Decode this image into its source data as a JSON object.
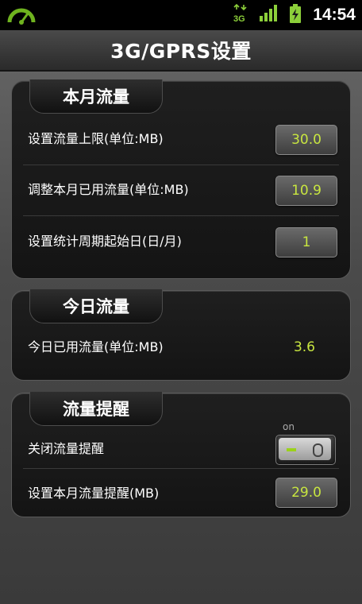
{
  "status_bar": {
    "time": "14:54",
    "network_label": "3G",
    "icons": [
      "speed-gauge-icon",
      "network-3g-icon",
      "signal-strength-icon",
      "battery-charging-icon"
    ]
  },
  "header": {
    "title": "3G/GPRS设置"
  },
  "monthly": {
    "title": "本月流量",
    "rows": [
      {
        "label": "设置流量上限(单位:MB)",
        "value": "30.0"
      },
      {
        "label": "调整本月已用流量(单位:MB)",
        "value": "10.9"
      },
      {
        "label": "设置统计周期起始日(日/月)",
        "value": "1"
      }
    ]
  },
  "today": {
    "title": "今日流量",
    "rows": [
      {
        "label": "今日已用流量(单位:MB)",
        "value": "3.6"
      }
    ]
  },
  "reminder": {
    "title": "流量提醒",
    "toggle_label": "关闭流量提醒",
    "toggle_state_text": "on",
    "toggle_on": true,
    "rows": [
      {
        "label": "设置本月流量提醒(MB)",
        "value": "29.0"
      }
    ]
  },
  "colors": {
    "accent_value": "#c8e640",
    "toggle_on": "#9bd21a"
  }
}
